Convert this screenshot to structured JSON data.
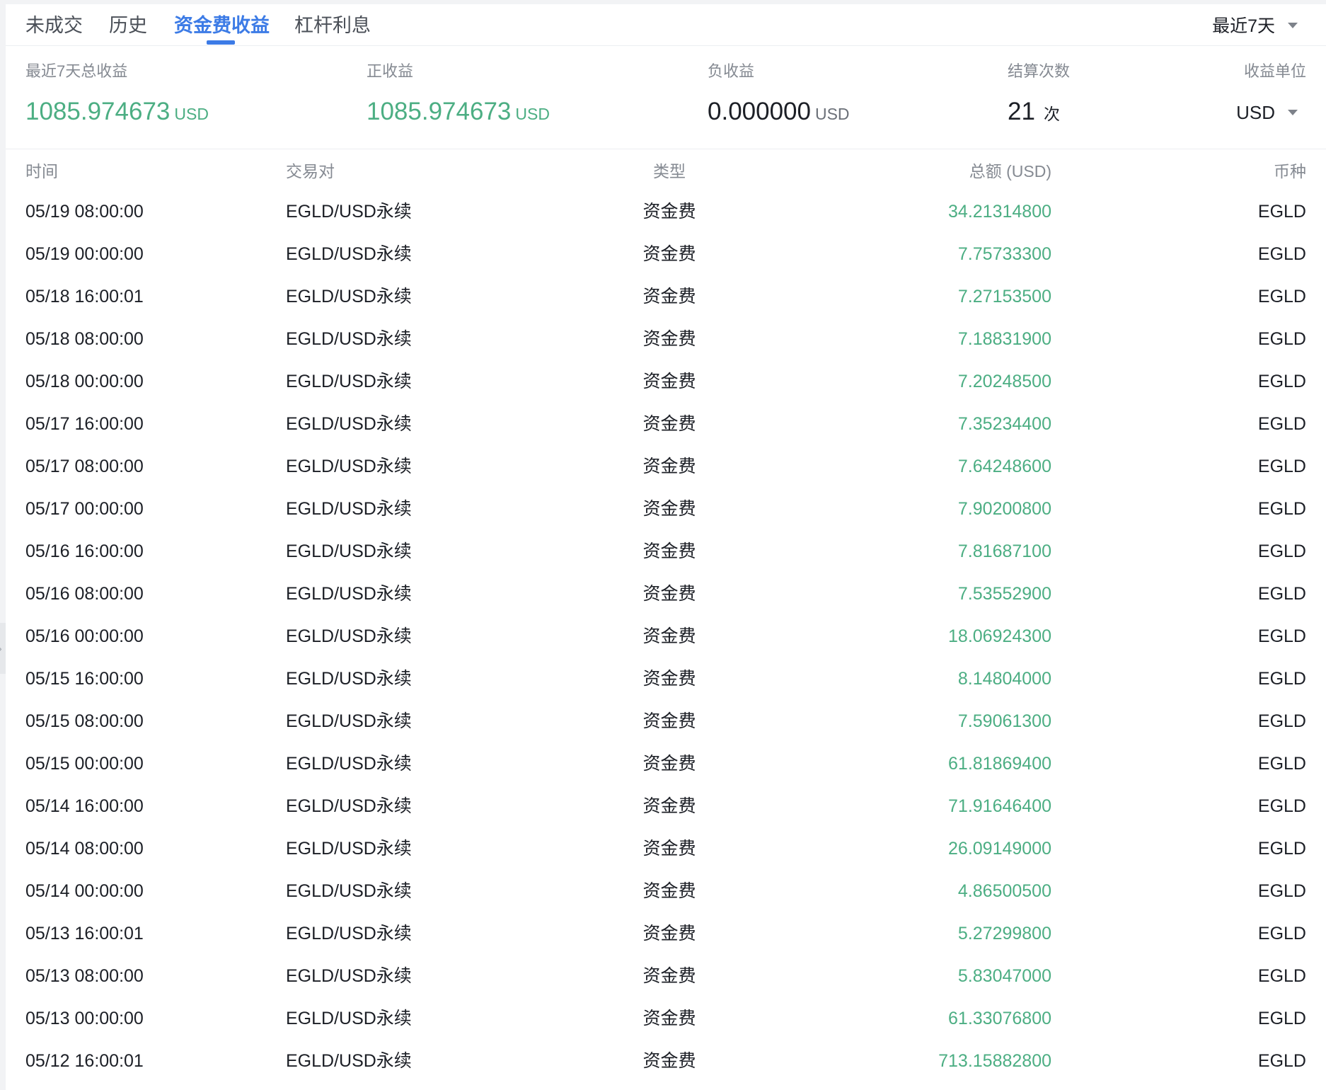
{
  "tabs": [
    {
      "label": "未成交",
      "active": false
    },
    {
      "label": "历史",
      "active": false
    },
    {
      "label": "资金费收益",
      "active": true
    },
    {
      "label": "杠杆利息",
      "active": false
    }
  ],
  "range_select": {
    "value": "最近7天"
  },
  "summary": {
    "total": {
      "label": "最近7天总收益",
      "value": "1085.974673",
      "unit": "USD"
    },
    "positive": {
      "label": "正收益",
      "value": "1085.974673",
      "unit": "USD"
    },
    "negative": {
      "label": "负收益",
      "value": "0.000000",
      "unit": "USD"
    },
    "settlements": {
      "label": "结算次数",
      "value": "21",
      "unit": "次"
    },
    "unit_select": {
      "label": "收益单位",
      "value": "USD"
    }
  },
  "colors": {
    "accent": "#3c7be6",
    "positive": "#4cae83",
    "text": "#1c1f26",
    "muted": "#858a92"
  },
  "table": {
    "headers": {
      "time": "时间",
      "pair": "交易对",
      "type": "类型",
      "amount": "总额 (USD)",
      "coin": "币种"
    },
    "rows": [
      {
        "time": "05/19 08:00:00",
        "pair": "EGLD/USD永续",
        "type": "资金费",
        "amount": "34.21314800",
        "coin": "EGLD"
      },
      {
        "time": "05/19 00:00:00",
        "pair": "EGLD/USD永续",
        "type": "资金费",
        "amount": "7.75733300",
        "coin": "EGLD"
      },
      {
        "time": "05/18 16:00:01",
        "pair": "EGLD/USD永续",
        "type": "资金费",
        "amount": "7.27153500",
        "coin": "EGLD"
      },
      {
        "time": "05/18 08:00:00",
        "pair": "EGLD/USD永续",
        "type": "资金费",
        "amount": "7.18831900",
        "coin": "EGLD"
      },
      {
        "time": "05/18 00:00:00",
        "pair": "EGLD/USD永续",
        "type": "资金费",
        "amount": "7.20248500",
        "coin": "EGLD"
      },
      {
        "time": "05/17 16:00:00",
        "pair": "EGLD/USD永续",
        "type": "资金费",
        "amount": "7.35234400",
        "coin": "EGLD"
      },
      {
        "time": "05/17 08:00:00",
        "pair": "EGLD/USD永续",
        "type": "资金费",
        "amount": "7.64248600",
        "coin": "EGLD"
      },
      {
        "time": "05/17 00:00:00",
        "pair": "EGLD/USD永续",
        "type": "资金费",
        "amount": "7.90200800",
        "coin": "EGLD"
      },
      {
        "time": "05/16 16:00:00",
        "pair": "EGLD/USD永续",
        "type": "资金费",
        "amount": "7.81687100",
        "coin": "EGLD"
      },
      {
        "time": "05/16 08:00:00",
        "pair": "EGLD/USD永续",
        "type": "资金费",
        "amount": "7.53552900",
        "coin": "EGLD"
      },
      {
        "time": "05/16 00:00:00",
        "pair": "EGLD/USD永续",
        "type": "资金费",
        "amount": "18.06924300",
        "coin": "EGLD"
      },
      {
        "time": "05/15 16:00:00",
        "pair": "EGLD/USD永续",
        "type": "资金费",
        "amount": "8.14804000",
        "coin": "EGLD"
      },
      {
        "time": "05/15 08:00:00",
        "pair": "EGLD/USD永续",
        "type": "资金费",
        "amount": "7.59061300",
        "coin": "EGLD"
      },
      {
        "time": "05/15 00:00:00",
        "pair": "EGLD/USD永续",
        "type": "资金费",
        "amount": "61.81869400",
        "coin": "EGLD"
      },
      {
        "time": "05/14 16:00:00",
        "pair": "EGLD/USD永续",
        "type": "资金费",
        "amount": "71.91646400",
        "coin": "EGLD"
      },
      {
        "time": "05/14 08:00:00",
        "pair": "EGLD/USD永续",
        "type": "资金费",
        "amount": "26.09149000",
        "coin": "EGLD"
      },
      {
        "time": "05/14 00:00:00",
        "pair": "EGLD/USD永续",
        "type": "资金费",
        "amount": "4.86500500",
        "coin": "EGLD"
      },
      {
        "time": "05/13 16:00:01",
        "pair": "EGLD/USD永续",
        "type": "资金费",
        "amount": "5.27299800",
        "coin": "EGLD"
      },
      {
        "time": "05/13 08:00:00",
        "pair": "EGLD/USD永续",
        "type": "资金费",
        "amount": "5.83047000",
        "coin": "EGLD"
      },
      {
        "time": "05/13 00:00:00",
        "pair": "EGLD/USD永续",
        "type": "资金费",
        "amount": "61.33076800",
        "coin": "EGLD"
      },
      {
        "time": "05/12 16:00:01",
        "pair": "EGLD/USD永续",
        "type": "资金费",
        "amount": "713.15882800",
        "coin": "EGLD"
      }
    ]
  }
}
